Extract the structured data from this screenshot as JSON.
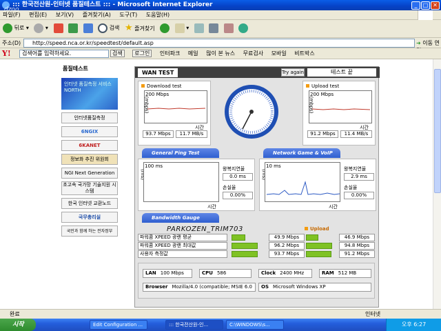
{
  "window": {
    "title": "::: 한국전산원-인터넷 품질테스트 ::: - Microsoft Internet Explorer",
    "overlay_top_left": "dzoo"
  },
  "menu": [
    "파일(F)",
    "편집(E)",
    "보기(V)",
    "즐겨찾기(A)",
    "도구(T)",
    "도움말(H)"
  ],
  "toolbar": {
    "back": "뒤로",
    "search": "검색",
    "favorites": "즐겨찾기"
  },
  "address": {
    "label": "주소(D)",
    "url": "http://speed.nca.or.kr/speedtest/default.asp",
    "go": "이동",
    "links": "연결"
  },
  "yahoo": {
    "logo": "Y!",
    "placeholder": "검색어를 입력하세요.",
    "search_btn": "검색",
    "login": "로그인",
    "items": [
      "인터파크",
      "메일",
      "많이 본 뉴스",
      "무료검사",
      "모바일",
      "비트박스"
    ]
  },
  "leftnav": {
    "header": "품질테스트",
    "hero": "인터넷 품질측정 서비스 NORTH",
    "items": [
      "인터넷품질측정",
      "6NGIX",
      "6KANET",
      "정보화 추진 위원회",
      "NGI Next Generation",
      "초고속 국가망 기술지원 시스템",
      "한국 인터넷 교환노드",
      "국무총리실",
      "국민과 함께 하는 전자정부"
    ]
  },
  "wan": {
    "tab": "WAN TEST",
    "try_again": "Try again",
    "test_end": "테스트 끝",
    "download": {
      "label": "Download test",
      "scale": "200 Mbps",
      "axis": "(mbps)",
      "time": "시간",
      "mbps": "93.7 Mbps",
      "mbs": "11.7 MB/s"
    },
    "upload": {
      "label": "Upload test",
      "scale": "200 Mbps",
      "axis": "(mbps)",
      "time": "시간",
      "mbps": "91.2 Mbps",
      "mbs": "11.4 MB/s"
    },
    "ping_hdr": "General Ping Test",
    "voip_hdr": "Network Game & VoIP Test",
    "ping": {
      "scale": "100 ms",
      "axis": "(ms)",
      "time": "시간",
      "rtt_label": "왕복지연율",
      "rtt": "0.0 ms",
      "loss_label": "손실율",
      "loss": "0.00%"
    },
    "voip": {
      "scale": "10 ms",
      "axis": "(ms)",
      "time": "시간",
      "rtt_label": "왕복지연율",
      "rtt": "2.9 ms",
      "loss_label": "손실율",
      "loss": "0.00%"
    },
    "bw_hdr": "Bandwidth Gauge",
    "upload_tag": "Upload",
    "rows": [
      {
        "name": "파워콤 XPEED 광랜 평균",
        "down": "49.9 Mbps",
        "up": "46.9 Mbps",
        "down_frac": 0.25,
        "up_frac": 0.23
      },
      {
        "name": "파워콤 XPEED 광랜 최대값",
        "down": "96.2 Mbps",
        "up": "94.8 Mbps",
        "down_frac": 0.48,
        "up_frac": 0.47
      },
      {
        "name": "사용자 측정값",
        "down": "93.7 Mbps",
        "up": "91.2 Mbps",
        "down_frac": 0.47,
        "up_frac": 0.46
      }
    ],
    "specs": {
      "lan_l": "LAN",
      "lan": "100 Mbps",
      "cpu_l": "CPU",
      "cpu": "586",
      "clock_l": "Clock",
      "clock": "2400 MHz",
      "ram_l": "RAM",
      "ram": "512 MB",
      "browser_l": "Browser",
      "browser": "Mozilla/4.0 (compatible; MSIE 6.0",
      "os_l": "OS",
      "os": "Microsoft Windows XP"
    }
  },
  "watermark": "PARKOZEN_TRIM703",
  "status": {
    "text": "완료",
    "zone": "인터넷"
  },
  "taskbar": {
    "start": "시작",
    "tasks": [
      "Edit Configuration ...",
      "::: 한국전산원-인...",
      "C:\\WINDOWS\\s..."
    ],
    "clock": "오후 6:27"
  },
  "colors": {
    "bar_green": "#7fc224",
    "accent_blue": "#2f5fd0",
    "gauge_blue": "#1f4fb3"
  }
}
